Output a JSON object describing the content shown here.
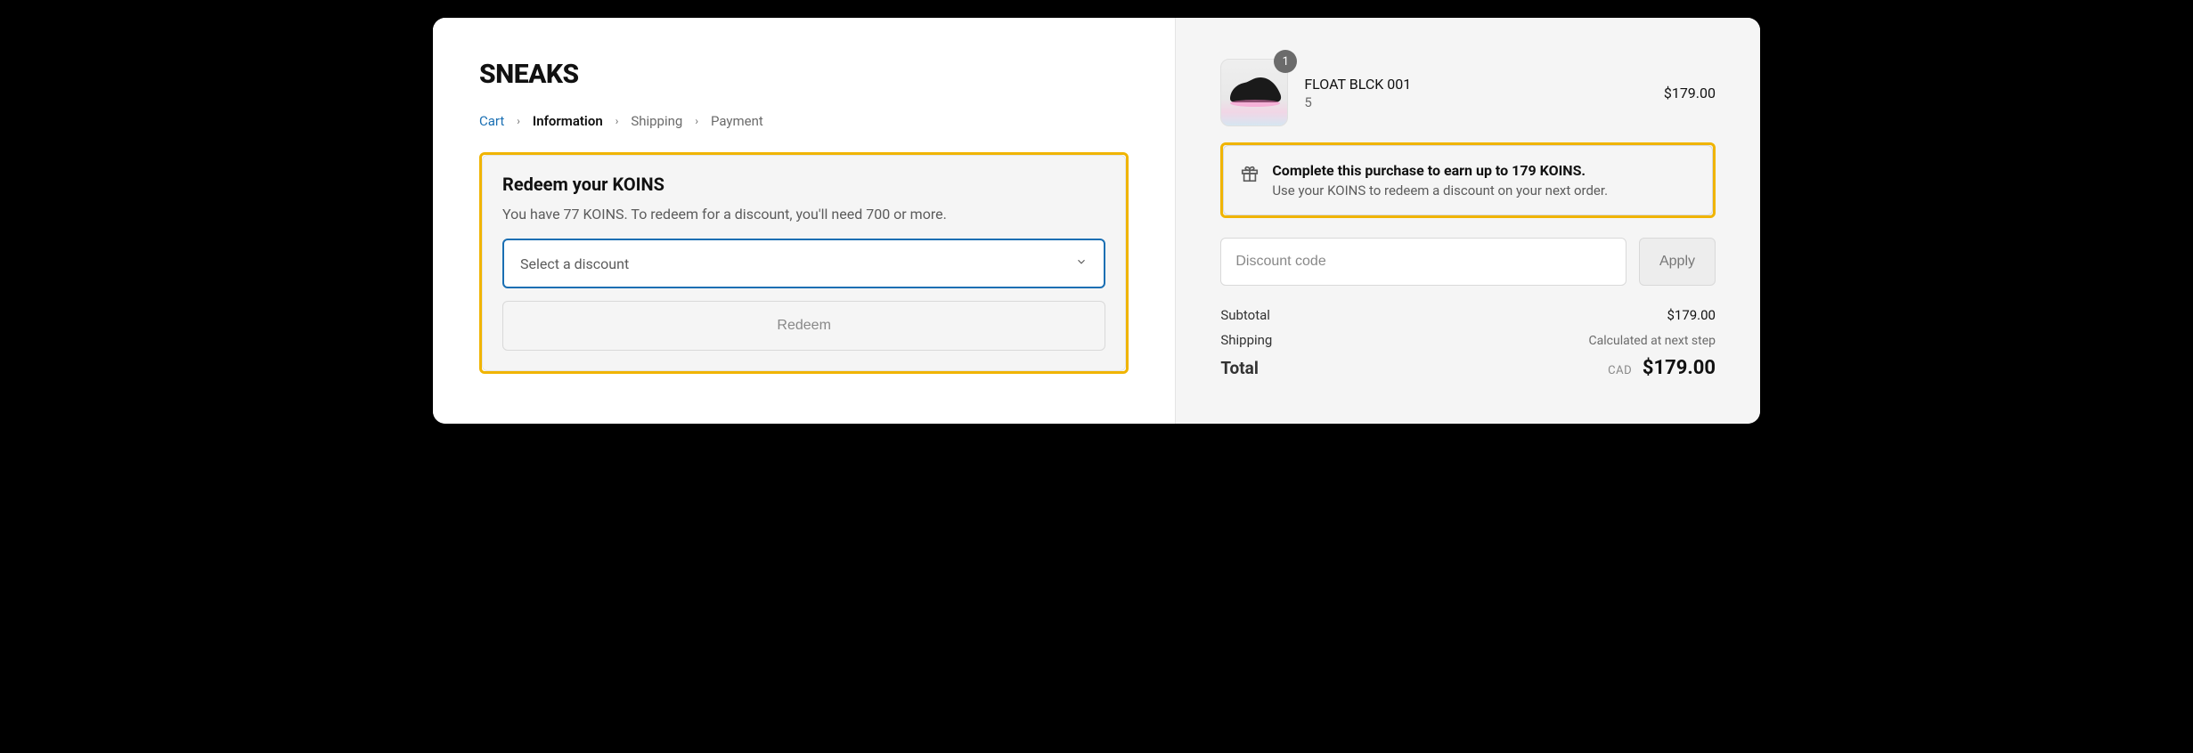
{
  "brand": "SNEAKS",
  "breadcrumb": {
    "cart": "Cart",
    "information": "Information",
    "shipping": "Shipping",
    "payment": "Payment"
  },
  "redeem": {
    "title": "Redeem your KOINS",
    "subtitle": "You have 77 KOINS. To redeem for a discount, you'll need 700 or more.",
    "select_placeholder": "Select a discount",
    "button": "Redeem"
  },
  "cart": {
    "item": {
      "name": "FLOAT BLCK 001",
      "variant": "5",
      "qty": "1",
      "price": "$179.00"
    }
  },
  "earn": {
    "title": "Complete this purchase to earn up to 179 KOINS.",
    "subtitle": "Use your KOINS to redeem a discount on your next order."
  },
  "discount": {
    "placeholder": "Discount code",
    "apply": "Apply"
  },
  "totals": {
    "subtotal_label": "Subtotal",
    "subtotal_value": "$179.00",
    "shipping_label": "Shipping",
    "shipping_value": "Calculated at next step",
    "total_label": "Total",
    "total_currency": "CAD",
    "total_value": "$179.00"
  }
}
